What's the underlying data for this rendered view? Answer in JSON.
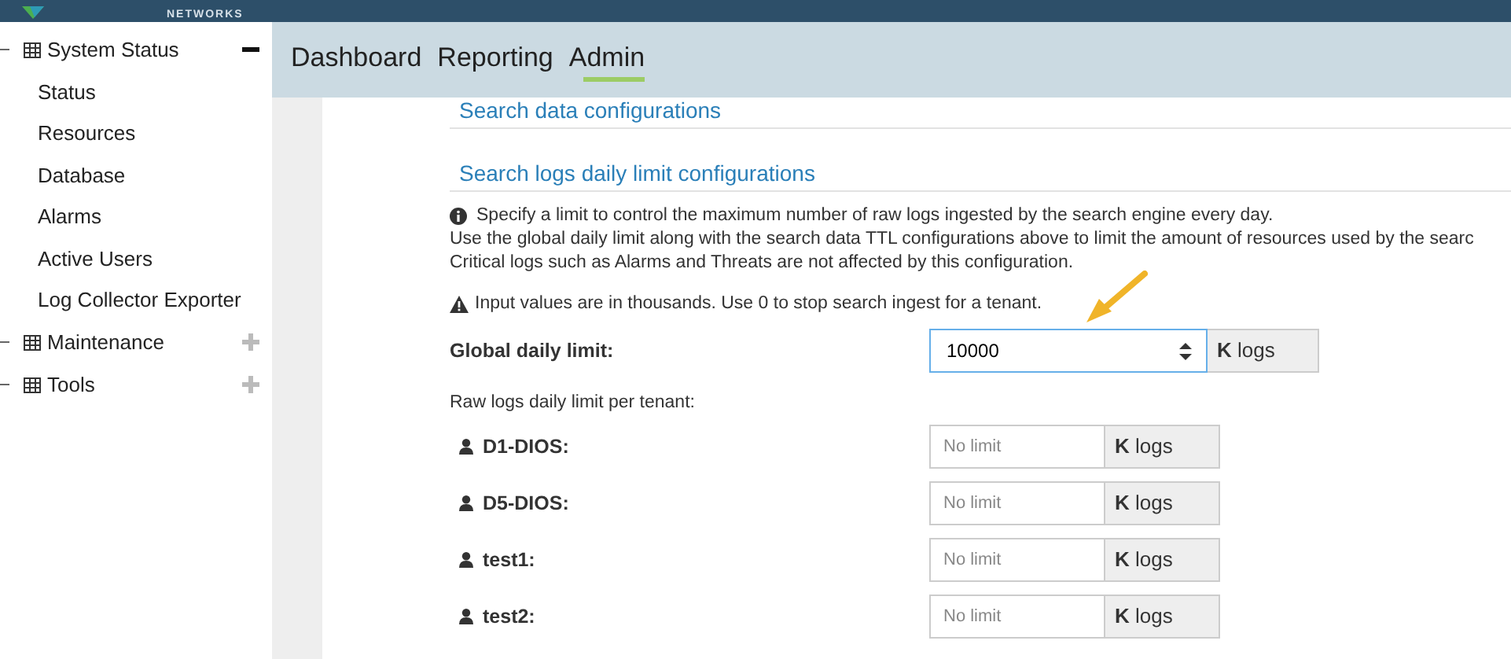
{
  "logo": {
    "subtitle": "NETWORKS"
  },
  "sidebar": {
    "groups": [
      {
        "label": "System Status",
        "expanded": true,
        "children": [
          {
            "label": "Status"
          },
          {
            "label": "Resources"
          },
          {
            "label": "Database"
          },
          {
            "label": "Alarms"
          },
          {
            "label": "Active Users"
          },
          {
            "label": "Log Collector Exporter"
          }
        ]
      },
      {
        "label": "Maintenance",
        "expanded": false
      },
      {
        "label": "Tools",
        "expanded": false
      }
    ]
  },
  "nav": {
    "tabs": [
      {
        "label": "Dashboard",
        "selected": false
      },
      {
        "label": "Reporting",
        "selected": false
      },
      {
        "label": "Admin",
        "selected": true
      }
    ]
  },
  "sections": [
    {
      "title": "Search data configurations"
    },
    {
      "title": "Search logs daily limit configurations"
    }
  ],
  "info": [
    "Specify a limit to control the maximum number of raw logs ingested by the search engine every day.",
    "Use the global daily limit along with the search data TTL configurations above to limit the amount of resources used by the searc",
    "Critical logs such as Alarms and Threats are not affected by this configuration."
  ],
  "warning": "Input values are in thousands. Use 0 to stop search ingest for a tenant.",
  "global_limit": {
    "label": "Global daily limit:",
    "value": "10000",
    "unit_bold": "K",
    "unit": "logs"
  },
  "tenant_heading": "Raw logs daily limit per tenant:",
  "tenants": [
    {
      "name": "D1-DIOS:",
      "placeholder": "No limit",
      "unit_bold": "K",
      "unit": "logs"
    },
    {
      "name": "D5-DIOS:",
      "placeholder": "No limit",
      "unit_bold": "K",
      "unit": "logs"
    },
    {
      "name": "test1:",
      "placeholder": "No limit",
      "unit_bold": "K",
      "unit": "logs"
    },
    {
      "name": "test2:",
      "placeholder": "No limit",
      "unit_bold": "K",
      "unit": "logs"
    }
  ]
}
